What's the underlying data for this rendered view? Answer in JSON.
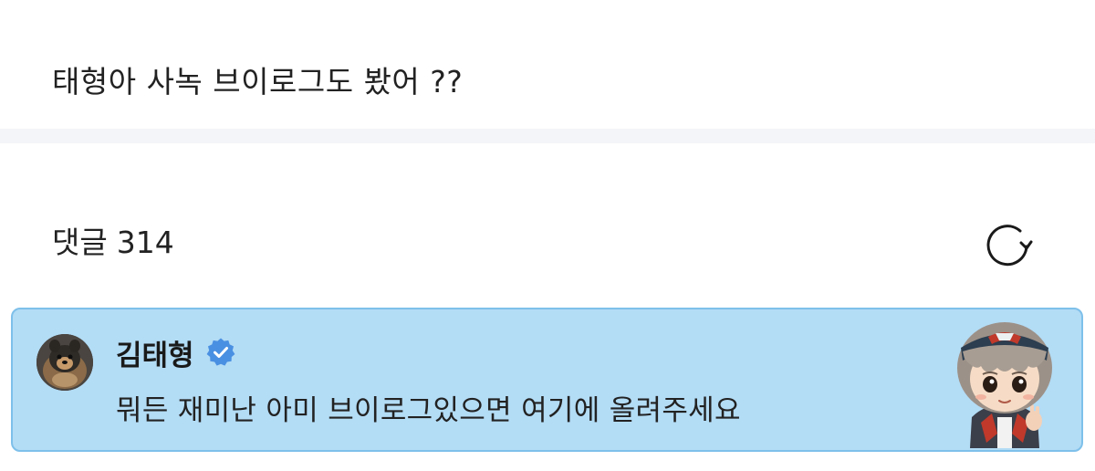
{
  "post": {
    "question": "태형아 사녹 브이로그도 봤어 ??"
  },
  "comments": {
    "label": "댓글",
    "count": "314",
    "refresh_icon": "refresh-icon"
  },
  "pinned_comment": {
    "author": "김태형",
    "verified_icon": "verified-badge-icon",
    "text": "뭐든 재미난 아미 브이로그있으면 여기에 올려주세요",
    "colors": {
      "background": "#b3dcf5",
      "border": "#7ec0ea",
      "verified": "#4a90e2"
    }
  }
}
